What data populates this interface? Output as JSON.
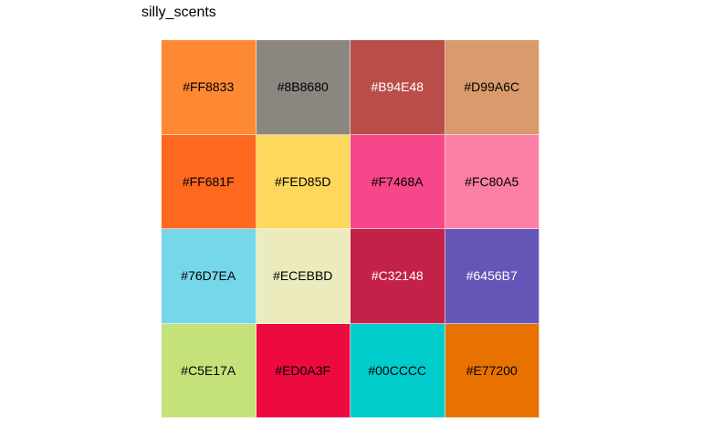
{
  "title": "silly_scents",
  "chart_data": {
    "type": "heatmap",
    "title": "silly_scents",
    "rows": 4,
    "cols": 4,
    "cells": [
      {
        "hex": "#FF8833",
        "label": "#FF8833",
        "label_color": "#000000"
      },
      {
        "hex": "#8B8680",
        "label": "#8B8680",
        "label_color": "#000000"
      },
      {
        "hex": "#B94E48",
        "label": "#B94E48",
        "label_color": "#ffffff"
      },
      {
        "hex": "#D99A6C",
        "label": "#D99A6C",
        "label_color": "#000000"
      },
      {
        "hex": "#FF681F",
        "label": "#FF681F",
        "label_color": "#000000"
      },
      {
        "hex": "#FED85D",
        "label": "#FED85D",
        "label_color": "#000000"
      },
      {
        "hex": "#F7468A",
        "label": "#F7468A",
        "label_color": "#000000"
      },
      {
        "hex": "#FC80A5",
        "label": "#FC80A5",
        "label_color": "#000000"
      },
      {
        "hex": "#76D7EA",
        "label": "#76D7EA",
        "label_color": "#000000"
      },
      {
        "hex": "#ECEBBD",
        "label": "#ECEBBD",
        "label_color": "#000000"
      },
      {
        "hex": "#C32148",
        "label": "#C32148",
        "label_color": "#ffffff"
      },
      {
        "hex": "#6456B7",
        "label": "#6456B7",
        "label_color": "#ffffff"
      },
      {
        "hex": "#C5E17A",
        "label": "#C5E17A",
        "label_color": "#000000"
      },
      {
        "hex": "#ED0A3F",
        "label": "#ED0A3F",
        "label_color": "#000000"
      },
      {
        "hex": "#00CCCC",
        "label": "#00CCCC",
        "label_color": "#000000"
      },
      {
        "hex": "#E77200",
        "label": "#E77200",
        "label_color": "#000000"
      }
    ]
  }
}
